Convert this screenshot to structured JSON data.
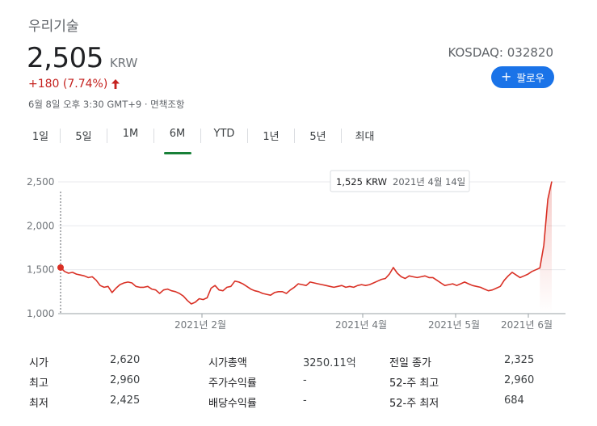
{
  "header": {
    "company": "우리기술",
    "price": "2,505",
    "currency": "KRW",
    "change": "+180 (7.74%)",
    "meta": "6월 8일 오후 3:30 GMT+9 · 면책조항",
    "exchange": "KOSDAQ: 032820",
    "follow_label": "팔로우"
  },
  "colors": {
    "accent": "#1a73e8",
    "negative_red": "#c5221f",
    "chart_line": "#d93025",
    "active_tab": "#188038"
  },
  "tabs": [
    {
      "label": "1일"
    },
    {
      "label": "5일"
    },
    {
      "label": "1M"
    },
    {
      "label": "6M",
      "active": true
    },
    {
      "label": "YTD"
    },
    {
      "label": "1년"
    },
    {
      "label": "5년"
    },
    {
      "label": "최대"
    }
  ],
  "chart_data": {
    "type": "line",
    "ylim": [
      1000,
      2600
    ],
    "y_ticks": [
      "2,500",
      "2,000",
      "1,500",
      "1,000"
    ],
    "x_ticks": [
      "2021년 2월",
      "2021년 4월",
      "2021년 5월",
      "2021년 6월"
    ],
    "tooltip": {
      "value": "1,525 KRW",
      "date": "2021년 4월 14일"
    },
    "highlight_value": 1525,
    "values": [
      1525,
      1480,
      1460,
      1470,
      1450,
      1440,
      1430,
      1410,
      1420,
      1380,
      1320,
      1300,
      1310,
      1240,
      1290,
      1330,
      1350,
      1360,
      1350,
      1310,
      1300,
      1300,
      1310,
      1280,
      1270,
      1230,
      1270,
      1280,
      1260,
      1250,
      1230,
      1200,
      1150,
      1110,
      1130,
      1170,
      1160,
      1180,
      1290,
      1320,
      1270,
      1260,
      1300,
      1310,
      1370,
      1360,
      1340,
      1310,
      1280,
      1260,
      1250,
      1230,
      1220,
      1210,
      1240,
      1250,
      1250,
      1230,
      1270,
      1300,
      1340,
      1330,
      1320,
      1360,
      1350,
      1340,
      1330,
      1320,
      1310,
      1300,
      1310,
      1320,
      1300,
      1310,
      1300,
      1320,
      1330,
      1320,
      1330,
      1350,
      1370,
      1390,
      1400,
      1450,
      1525,
      1460,
      1420,
      1400,
      1430,
      1420,
      1410,
      1420,
      1430,
      1410,
      1410,
      1380,
      1350,
      1320,
      1330,
      1340,
      1320,
      1340,
      1360,
      1340,
      1320,
      1310,
      1300,
      1280,
      1260,
      1270,
      1290,
      1310,
      1380,
      1430,
      1470,
      1440,
      1410,
      1430,
      1450,
      1480,
      1500,
      1520,
      1780,
      2300,
      2505
    ]
  },
  "stats": [
    {
      "label": "시가",
      "value": "2,620"
    },
    {
      "label": "최고",
      "value": "2,960"
    },
    {
      "label": "최저",
      "value": "2,425"
    },
    {
      "label": "시가총액",
      "value": "3250.11억"
    },
    {
      "label": "주가수익률",
      "value": "-"
    },
    {
      "label": "배당수익률",
      "value": "-"
    },
    {
      "label": "전일 종가",
      "value": "2,325"
    },
    {
      "label": "52-주 최고",
      "value": "2,960"
    },
    {
      "label": "52-주 최저",
      "value": "684"
    }
  ]
}
